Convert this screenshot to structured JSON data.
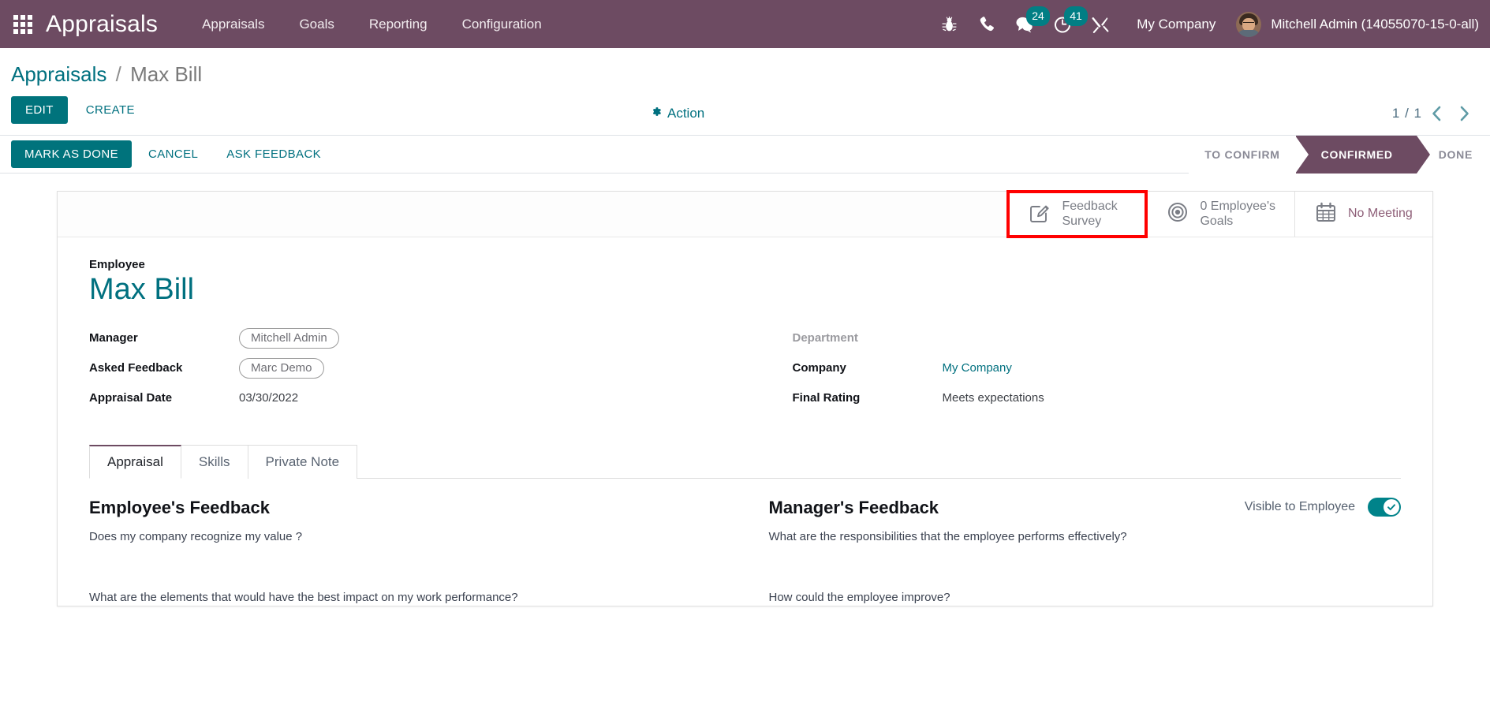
{
  "navbar": {
    "apps_icon": "apps-grid-icon",
    "brand": "Appraisals",
    "menu": [
      {
        "label": "Appraisals"
      },
      {
        "label": "Goals"
      },
      {
        "label": "Reporting"
      },
      {
        "label": "Configuration"
      }
    ],
    "sys_icons": [
      {
        "name": "bug-icon",
        "badge": ""
      },
      {
        "name": "phone-icon",
        "badge": ""
      },
      {
        "name": "messages-icon",
        "badge": "24"
      },
      {
        "name": "activities-clock-icon",
        "badge": "41"
      },
      {
        "name": "tools-icon",
        "badge": ""
      }
    ],
    "company": "My Company",
    "user": "Mitchell Admin (14055070-15-0-all)",
    "accent": "#6d4b62",
    "badge_color": "#017e84"
  },
  "breadcrumb": {
    "root": "Appraisals",
    "separator": "/",
    "current": "Max Bill"
  },
  "control_panel": {
    "edit_label": "EDIT",
    "create_label": "CREATE",
    "action_label": "Action",
    "action_icon": "gear-icon",
    "pager_counter": "1 / 1",
    "prev_icon": "chevron-left-icon",
    "next_icon": "chevron-right-icon"
  },
  "statusbar": {
    "buttons": [
      {
        "label": "MARK AS DONE",
        "style": "primary"
      },
      {
        "label": "CANCEL",
        "style": "link"
      },
      {
        "label": "ASK FEEDBACK",
        "style": "link"
      }
    ],
    "stages": [
      {
        "label": "TO CONFIRM",
        "active": false
      },
      {
        "label": "CONFIRMED",
        "active": true
      },
      {
        "label": "DONE",
        "active": false
      }
    ]
  },
  "stat_buttons": [
    {
      "name": "feedback-survey",
      "icon": "pencil-square-icon",
      "line1": "Feedback",
      "line2": "Survey",
      "highlighted": true
    },
    {
      "name": "employees-goals",
      "icon": "bullseye-icon",
      "line1": "0 Employee's",
      "line2": "Goals",
      "highlighted": false
    },
    {
      "name": "meeting",
      "icon": "calendar-icon",
      "line1": "No Meeting",
      "line2": "",
      "highlighted": false
    }
  ],
  "form": {
    "employee_caption": "Employee",
    "employee_name": "Max Bill",
    "left_fields": [
      {
        "label": "Manager",
        "value": "Mitchell Admin",
        "type": "pill"
      },
      {
        "label": "Asked Feedback",
        "value": "Marc Demo",
        "type": "pill"
      },
      {
        "label": "Appraisal Date",
        "value": "03/30/2022",
        "type": "text"
      }
    ],
    "right_fields": [
      {
        "label": "Department",
        "value": "",
        "type": "text",
        "muted": true
      },
      {
        "label": "Company",
        "value": "My Company",
        "type": "link"
      },
      {
        "label": "Final Rating",
        "value": "Meets expectations",
        "type": "text"
      }
    ]
  },
  "notebook": {
    "tabs": [
      {
        "label": "Appraisal",
        "active": true
      },
      {
        "label": "Skills",
        "active": false
      },
      {
        "label": "Private Note",
        "active": false
      }
    ]
  },
  "appraisal_tab": {
    "employee_feedback": {
      "title": "Employee's Feedback",
      "questions": [
        "Does my company recognize my value ?",
        "What are the elements that would have the best impact on my work performance?"
      ]
    },
    "manager_feedback": {
      "title": "Manager's Feedback",
      "questions": [
        "What are the responsibilities that the employee performs effectively?",
        "How could the employee improve?"
      ],
      "visible_label": "Visible to Employee",
      "visible_on": true
    }
  }
}
